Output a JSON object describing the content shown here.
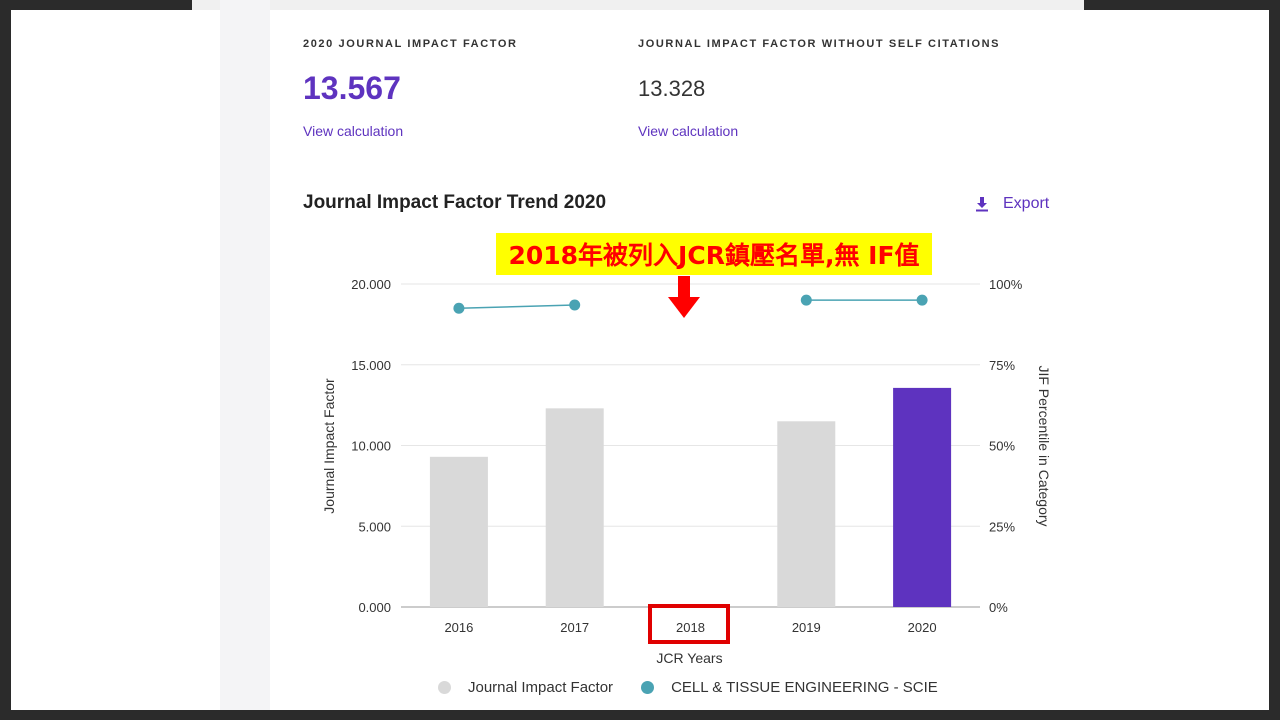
{
  "metrics": {
    "jif": {
      "label": "2020 JOURNAL IMPACT FACTOR",
      "value": "13.567",
      "link": "View calculation"
    },
    "jif_no_self": {
      "label": "JOURNAL IMPACT FACTOR WITHOUT SELF CITATIONS",
      "value": "13.328",
      "link": "View calculation"
    }
  },
  "chart_title": "Journal Impact Factor Trend 2020",
  "export_label": "Export",
  "annotation": "2018年被列入JCR鎮壓名單,無 IF值",
  "colors": {
    "accent": "#5e33bf",
    "bar_default": "#d9d9d9",
    "bar_highlight": "#5e33bf",
    "percentile": "#4aa3b3",
    "annotation_bg": "#ffff00",
    "annotation_text": "#ff0000"
  },
  "chart_data": {
    "type": "bar",
    "title": "Journal Impact Factor Trend 2020",
    "categories": [
      "2016",
      "2017",
      "2018",
      "2019",
      "2020"
    ],
    "xlabel": "JCR Years",
    "ylabel": "Journal Impact Factor",
    "y2label": "JIF Percentile in Category",
    "ylim": [
      0,
      20
    ],
    "y2lim": [
      0,
      100
    ],
    "yticks": [
      "0.000",
      "5.000",
      "10.000",
      "15.000",
      "20.000"
    ],
    "y2ticks": [
      "0%",
      "25%",
      "50%",
      "75%",
      "100%"
    ],
    "grid": true,
    "legend_position": "bottom",
    "highlight_category": "2020",
    "series": [
      {
        "name": "Journal Impact Factor",
        "type": "bar",
        "values": [
          9.3,
          12.3,
          null,
          11.5,
          13.567
        ]
      },
      {
        "name": "CELL & TISSUE ENGINEERING - SCIE",
        "type": "line",
        "values": [
          92.5,
          93.5,
          null,
          95,
          95
        ]
      }
    ]
  }
}
